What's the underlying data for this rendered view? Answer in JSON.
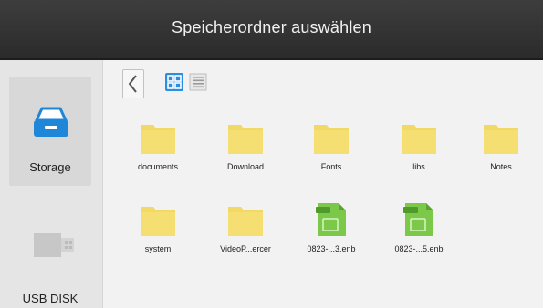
{
  "dialog": {
    "title": "Speicherordner auswählen"
  },
  "sidebar": {
    "items": [
      {
        "label": "Storage",
        "icon": "storage-icon",
        "selected": true
      },
      {
        "label": "USB DISK",
        "icon": "usb-disk-icon",
        "selected": false
      }
    ]
  },
  "toolbar": {
    "back_icon": "chevron-left-icon",
    "grid_view_icon": "grid-view-icon",
    "list_view_icon": "list-view-icon",
    "active_view": "grid"
  },
  "files": [
    {
      "name": "documents",
      "type": "folder"
    },
    {
      "name": "Download",
      "type": "folder"
    },
    {
      "name": "Fonts",
      "type": "folder"
    },
    {
      "name": "libs",
      "type": "folder"
    },
    {
      "name": "Notes",
      "type": "folder"
    },
    {
      "name": "system",
      "type": "folder"
    },
    {
      "name": "VideoP...ercer",
      "type": "folder"
    },
    {
      "name": "0823-...3.enb",
      "type": "enb-file"
    },
    {
      "name": "0823-...5.enb",
      "type": "enb-file"
    }
  ],
  "colors": {
    "titlebar": "#333333",
    "folder": "#f2d864",
    "enb_file": "#7cc94a",
    "accent": "#2a8fe0"
  }
}
